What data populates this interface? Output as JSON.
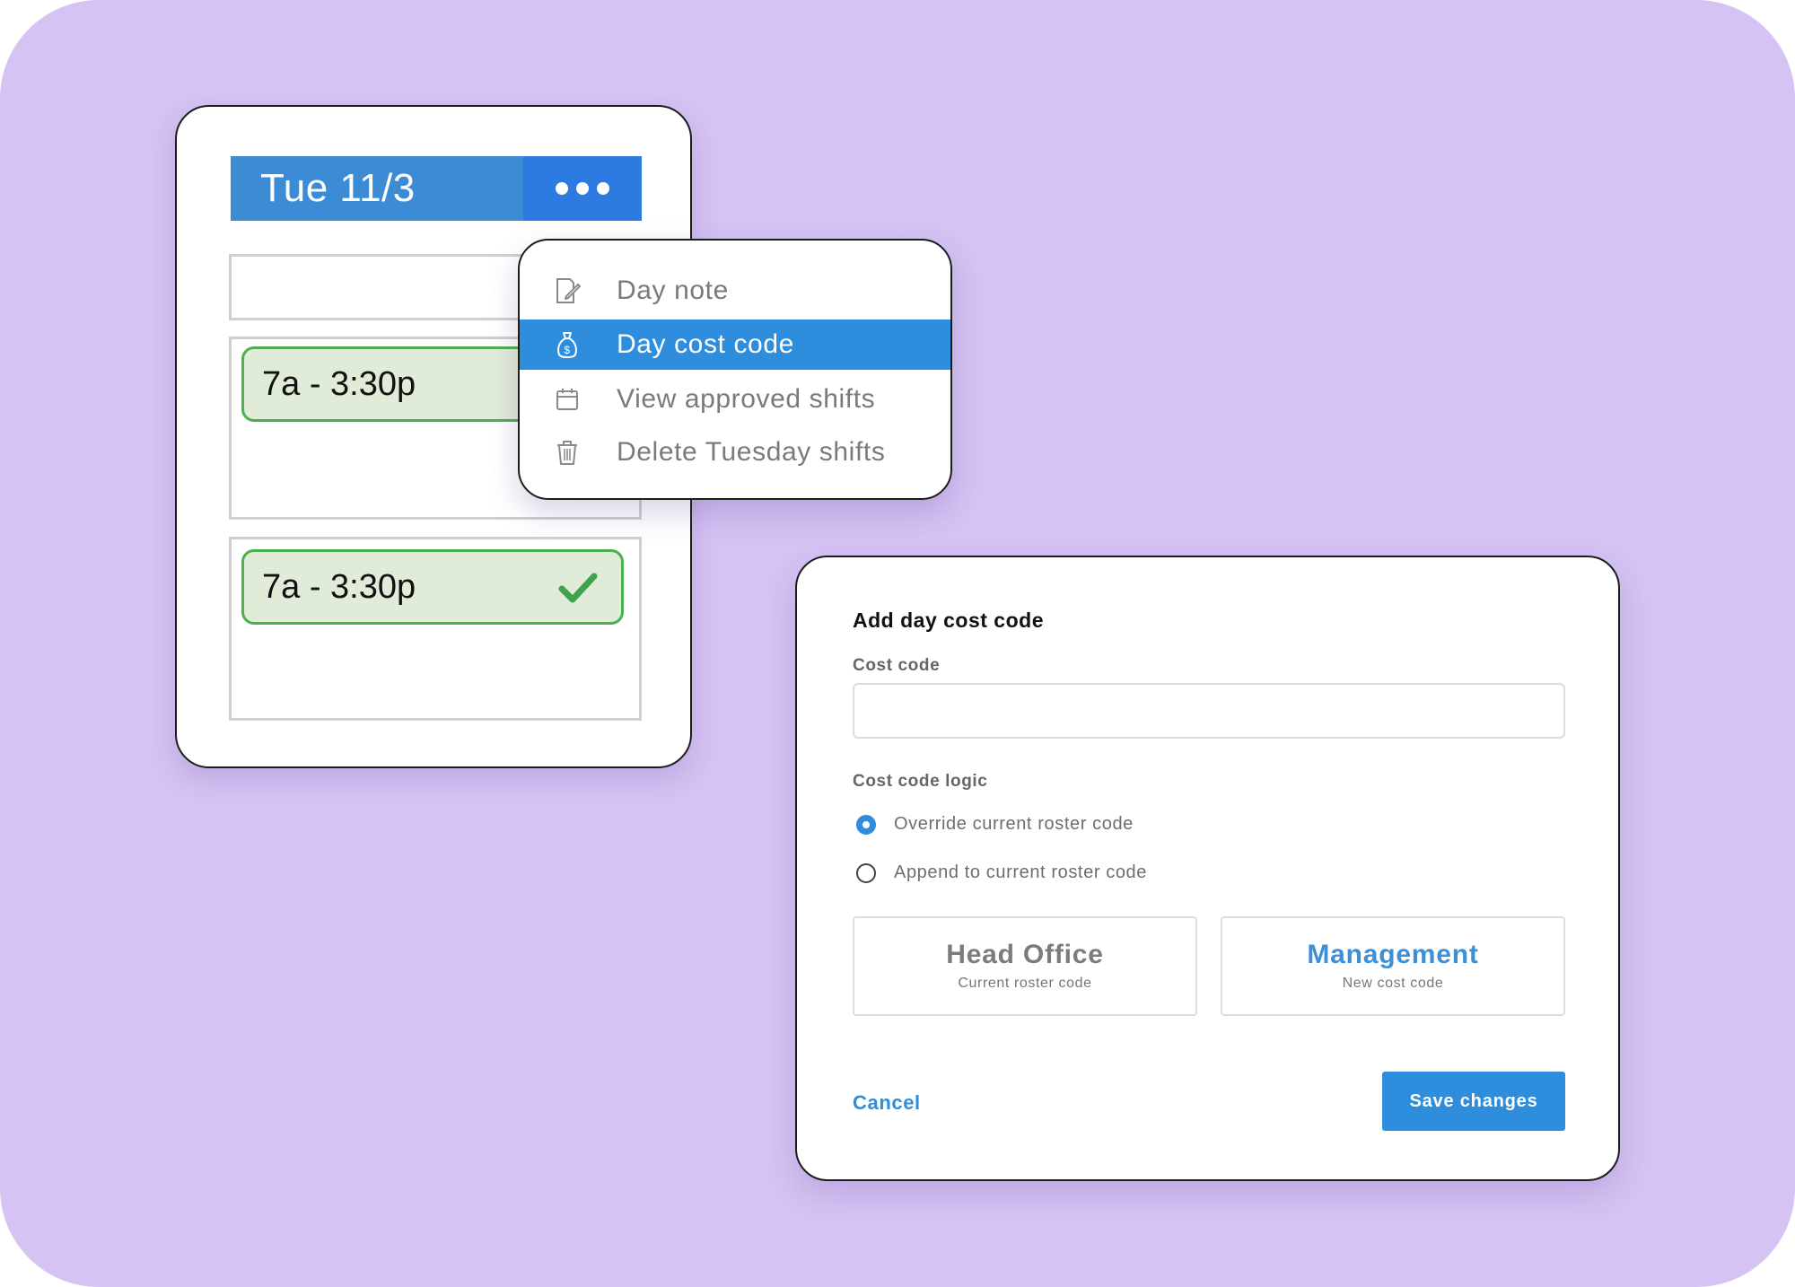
{
  "day_card": {
    "title": "Tue 11/3",
    "more_icon": "ellipsis-icon",
    "shifts": [
      {
        "time": "7a - 3:30p",
        "approved": false
      },
      {
        "time": "7a - 3:30p",
        "approved": true
      }
    ],
    "check_icon": "checkmark-icon",
    "colors": {
      "header": "#3b8cd4",
      "more": "#2d7be0",
      "shift_bg": "#e0ecd8",
      "shift_border": "#4caf50"
    }
  },
  "menu": {
    "items": [
      {
        "label": "Day note",
        "icon": "note-edit-icon",
        "active": false
      },
      {
        "label": "Day cost code",
        "icon": "money-bag-icon",
        "active": true
      },
      {
        "label": "View approved shifts",
        "icon": "calendar-icon",
        "active": false
      },
      {
        "label": "Delete Tuesday shifts",
        "icon": "trash-icon",
        "active": false
      }
    ],
    "active_color": "#2e8ddd"
  },
  "dialog": {
    "title": "Add day cost code",
    "cost_code_label": "Cost code",
    "cost_code_value": "",
    "logic_label": "Cost code logic",
    "options": [
      {
        "label": "Override current roster code",
        "selected": true
      },
      {
        "label": "Append to current roster code",
        "selected": false
      }
    ],
    "codes": [
      {
        "name": "Head Office",
        "caption": "Current roster code"
      },
      {
        "name": "Management",
        "caption": "New cost code"
      }
    ],
    "cancel_label": "Cancel",
    "save_label": "Save changes",
    "accent_color": "#2e8ddd"
  },
  "background_color": "#d5c3f4"
}
